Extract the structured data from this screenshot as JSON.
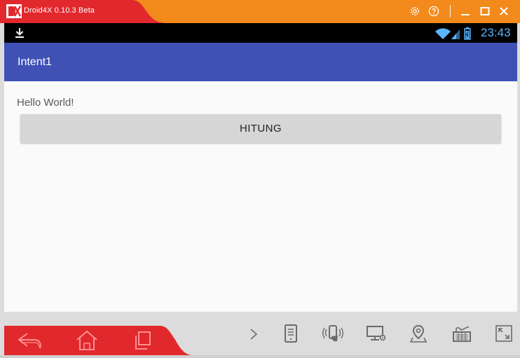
{
  "window": {
    "title": "Droid4X 0.10.3 Beta",
    "accent_red": "#e1282d",
    "accent_orange": "#f38a1c"
  },
  "titlebar_buttons": [
    "gear-icon",
    "help-icon",
    "minimize-icon",
    "maximize-icon",
    "close-icon"
  ],
  "status_bar": {
    "time": "23:43",
    "icons": [
      "download-icon",
      "wifi-icon",
      "signal-icon",
      "battery-icon"
    ]
  },
  "app_bar": {
    "title": "Intent1",
    "color": "#3f51b5"
  },
  "content": {
    "hello_text": "Hello World!",
    "button_label": "HITUNG"
  },
  "bottom_toolbar": {
    "nav": [
      "back-icon",
      "home-icon",
      "recent-apps-icon"
    ],
    "tools": [
      "expand-arrow-icon",
      "app-manager-icon",
      "shake-icon",
      "display-settings-icon",
      "location-icon",
      "keyboard-icon",
      "fullscreen-icon"
    ]
  }
}
